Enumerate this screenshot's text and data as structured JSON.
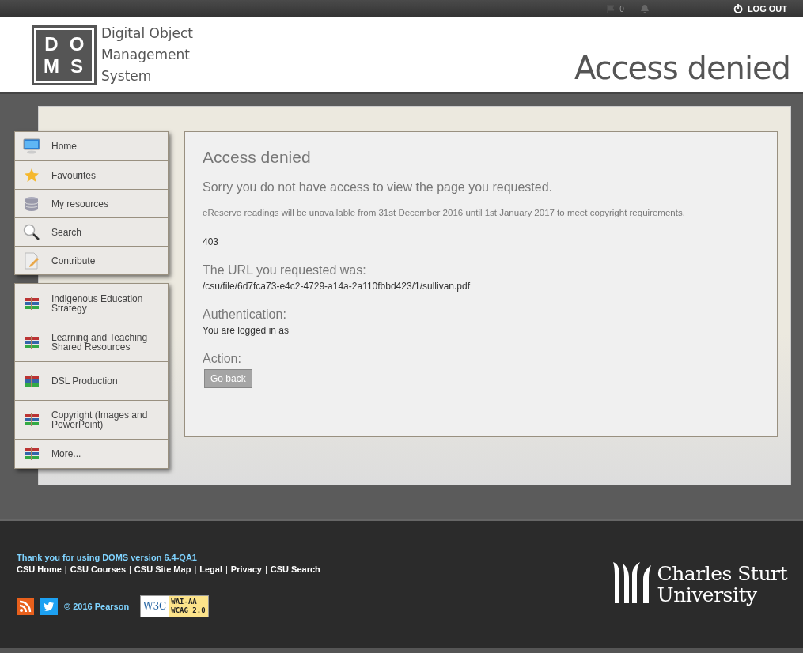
{
  "top_bar": {
    "flag_count": "0",
    "logout": "LOG OUT"
  },
  "header": {
    "logo_letters": [
      "D",
      "O",
      "M",
      "S"
    ],
    "logo_text": [
      "Digital Object",
      "Management",
      "System"
    ],
    "page_title": "Access denied"
  },
  "sidebar": {
    "primary": [
      {
        "label": "Home"
      },
      {
        "label": "Favourites"
      },
      {
        "label": "My resources"
      },
      {
        "label": "Search"
      },
      {
        "label": "Contribute"
      }
    ],
    "collections": [
      {
        "label": "Indigenous Education Strategy"
      },
      {
        "label": "Learning and Teaching Shared Resources"
      },
      {
        "label": "DSL Production"
      },
      {
        "label": "Copyright (Images and PowerPoint)"
      },
      {
        "label": "More..."
      }
    ]
  },
  "content": {
    "title": "Access denied",
    "message": "Sorry you do not have access to view the page you requested.",
    "notice": "eReserve readings will be unavailable from 31st December 2016 until 1st January 2017 to meet copyright requirements.",
    "code": "403",
    "sections": [
      {
        "heading": "The URL you requested was:",
        "text": "/csu/file/6d7fca73-e4c2-4729-a14a-2a110fbbd423/1/sullivan.pdf"
      },
      {
        "heading": "Authentication:",
        "text": "You are logged in as"
      },
      {
        "heading": "Action:",
        "button": "Go back"
      }
    ]
  },
  "footer": {
    "thanks": "Thank you for using DOMS version 6.4-QA1",
    "links": [
      "CSU Home",
      "CSU Courses",
      "CSU Site Map",
      "Legal",
      "Privacy",
      "CSU Search"
    ],
    "link_separator": "|",
    "copyright": "© 2016 Pearson",
    "badge": {
      "left": "W3C",
      "top": "WAI-AA",
      "bottom": "WCAG 2.0"
    },
    "university": [
      "Charles Sturt",
      "University"
    ]
  }
}
